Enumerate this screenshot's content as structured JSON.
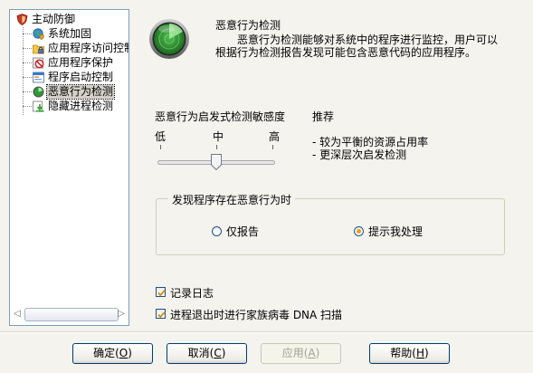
{
  "tree": {
    "root": {
      "label": "主动防御",
      "icon": "shield-icon"
    },
    "items": [
      {
        "label": "系统加固",
        "icon": "globe-shield-icon"
      },
      {
        "label": "应用程序访问控制",
        "icon": "folder-lock-icon"
      },
      {
        "label": "应用程序保护",
        "icon": "forbidden-app-icon"
      },
      {
        "label": "程序启动控制",
        "icon": "window-app-icon"
      },
      {
        "label": "恶意行为检测",
        "icon": "radar-icon"
      },
      {
        "label": "隐藏进程检测",
        "icon": "download-process-icon"
      }
    ],
    "selected_index": 4
  },
  "header": {
    "title": "恶意行为检测",
    "description_line1": "恶意行为检测能够对系统中的程序进行监控，用户可以",
    "description_line2": "根据行为检测报告发现可能包含恶意代码的应用程序。"
  },
  "sensitivity": {
    "label": "恶意行为启发式检测敏感度",
    "levels": [
      "低",
      "中",
      "高"
    ],
    "selected_level": "中",
    "recommend_title": "推荐",
    "recommend_line1": "- 较为平衡的资源占用率",
    "recommend_line2": "- 更深层次启发检测"
  },
  "on_detect": {
    "title": "发现程序存在恶意行为时",
    "options": [
      "仅报告",
      "提示我处理"
    ],
    "selected": "提示我处理"
  },
  "checkboxes": {
    "log_label": "记录日志",
    "log_checked": true,
    "dna_label": "进程退出时进行家族病毒 DNA 扫描",
    "dna_checked": true
  },
  "buttons": {
    "ok_label": "确定",
    "ok_key": "O",
    "cancel_label": "取消",
    "cancel_key": "C",
    "apply_label": "应用",
    "apply_key": "A",
    "help_label": "帮助",
    "help_key": "H"
  },
  "colors": {
    "radar_green": "#2f9a35",
    "selected_radio_dot": "#e8a020",
    "xp_button_border": "#003c74"
  }
}
